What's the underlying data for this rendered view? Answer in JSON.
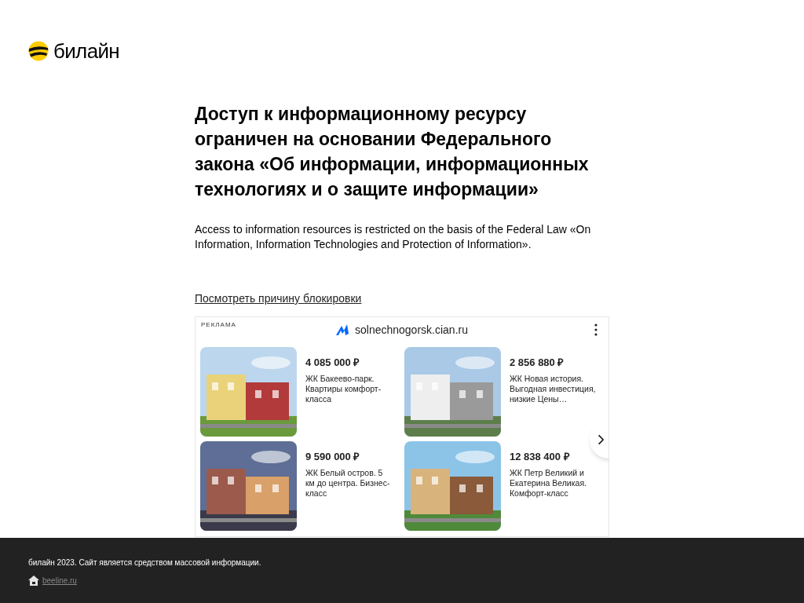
{
  "logo": {
    "text": "билайн"
  },
  "heading": "Доступ к информационному ресурсу ограничен на основании Федерального закона «Об информации, информационных технологиях и о защите информации»",
  "subtext": "Access to information resources is restricted on the basis of the Federal Law «On Information, Information Technologies and Protection of Information».",
  "reason_link": "Посмотреть причину блокировки",
  "ad": {
    "label": "РЕКЛАМА",
    "domain": "solnechnogorsk.cian.ru",
    "items": [
      {
        "price": "4 085 000 ₽",
        "description": "ЖК Бакеево-парк. Квартиры комфорт-класса",
        "kind": "picture"
      },
      {
        "price": "2 856 880 ₽",
        "description": "ЖК Новая история. Выгодная инвестиция, низкие Цены…",
        "kind": "picture"
      },
      {
        "price": "9 590 000 ₽",
        "description": "ЖК Белый остров. 5 км до центра. Бизнес-класс",
        "kind": "picture"
      },
      {
        "price": "12 838 400 ₽",
        "description": "ЖК Петр Великий и Екатерина Великая. Комфорт-класс",
        "kind": "picture"
      }
    ]
  },
  "footer": {
    "text": "билайн 2023. Сайт является средством массовой информации.",
    "link": "beeline.ru"
  }
}
